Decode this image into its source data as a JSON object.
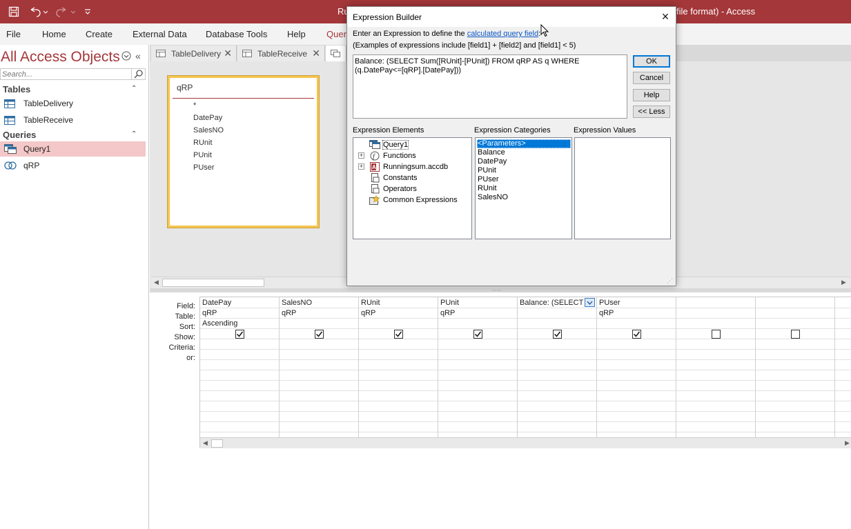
{
  "titlebar": {
    "title_left": "Ru",
    "title_right": "file format)  -  Access",
    "icons": [
      "save-icon",
      "undo-icon",
      "redo-icon",
      "customize-qat-icon"
    ]
  },
  "ribbon": {
    "tabs": [
      "File",
      "Home",
      "Create",
      "External Data",
      "Database Tools",
      "Help",
      "Quer"
    ]
  },
  "nav": {
    "title": "All Access Objects",
    "search_placeholder": "Search...",
    "groups": {
      "tables": {
        "label": "Tables",
        "items": [
          "TableDelivery",
          "TableReceive"
        ]
      },
      "queries": {
        "label": "Queries",
        "items": [
          "Query1",
          "qRP"
        ]
      }
    }
  },
  "doctabs": [
    "TableDelivery",
    "TableReceive"
  ],
  "fieldlist": {
    "title": "qRP",
    "fields": [
      "*",
      "DatePay",
      "SalesNO",
      "RUnit",
      "PUnit",
      "PUser"
    ]
  },
  "qbe": {
    "row_labels": [
      "Field:",
      "Table:",
      "Sort:",
      "Show:",
      "Criteria:",
      "or:"
    ],
    "columns": [
      {
        "field": "DatePay",
        "table": "qRP",
        "sort": "Ascending",
        "show": true
      },
      {
        "field": "SalesNO",
        "table": "qRP",
        "sort": "",
        "show": true
      },
      {
        "field": "RUnit",
        "table": "qRP",
        "sort": "",
        "show": true
      },
      {
        "field": "PUnit",
        "table": "qRP",
        "sort": "",
        "show": true
      },
      {
        "field": "Balance: (SELECT S",
        "table": "",
        "sort": "",
        "show": true
      },
      {
        "field": "PUser",
        "table": "qRP",
        "sort": "",
        "show": true
      },
      {
        "field": "",
        "table": "",
        "sort": "",
        "show": false
      },
      {
        "field": "",
        "table": "",
        "sort": "",
        "show": false
      }
    ]
  },
  "dialog": {
    "title": "Expression Builder",
    "intro": "Enter an Expression to define the ",
    "intro_link": "calculated query field",
    "intro_end": ":",
    "examples": "(Examples of expressions include [field1] + [field2] and [field1] < 5)",
    "expression": "Balance: (SELECT Sum([RUnit]-[PUnit]) FROM qRP AS q WHERE\n(q.DatePay<=[qRP].[DatePay]))",
    "buttons": {
      "ok": "OK",
      "cancel": "Cancel",
      "help": "Help",
      "less": "<< Less"
    },
    "elements_label": "Expression Elements",
    "categories_label": "Expression Categories",
    "values_label": "Expression Values",
    "elements": [
      "Query1",
      "Functions",
      "Runningsum.accdb",
      "Constants",
      "Operators",
      "Common Expressions"
    ],
    "categories": [
      "<Parameters>",
      "Balance",
      "DatePay",
      "PUnit",
      "PUser",
      "RUnit",
      "SalesNO"
    ]
  },
  "colors": {
    "accent": "#a4373a",
    "selection": "#f4c7c8",
    "dialog_selection": "#0078d7"
  }
}
